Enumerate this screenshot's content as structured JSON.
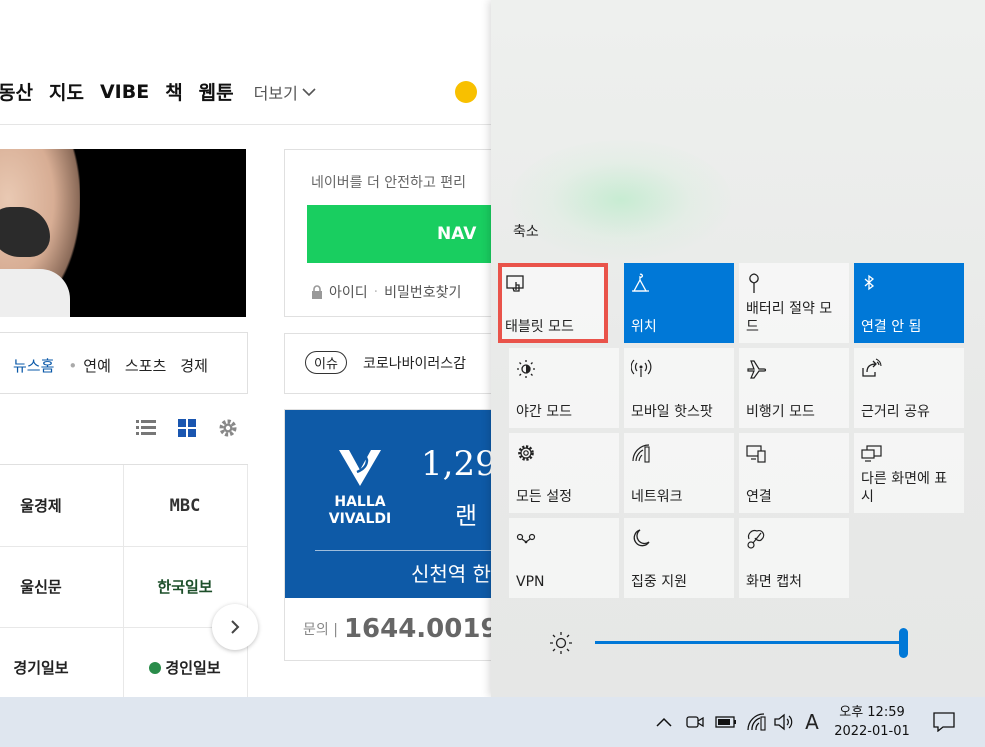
{
  "naver": {
    "nav_items": [
      "동산",
      "지도",
      "VIBE",
      "책",
      "웹툰"
    ],
    "nav_more": "더보기",
    "news_home": "뉴스홈",
    "news_links": [
      "연예",
      "스포츠",
      "경제"
    ],
    "press": [
      "울경제",
      "MBC",
      "울신문",
      "한국일보",
      "경기일보",
      "경인일보"
    ],
    "login_text": "네이버를 더 안전하고 편리",
    "login_button": "NAV",
    "login_id": "아이디",
    "login_pw": "비밀번호찾기",
    "issue_badge": "이슈",
    "issue_text": "코로나바이러스감",
    "ad_logo_line1": "HALLA",
    "ad_logo_line2": "VIVALDI",
    "ad_number": "1,29",
    "ad_sub": "랜",
    "ad_station": "신천역 한",
    "ad_phone_label": "문의 |",
    "ad_phone": "1644.0019"
  },
  "action_center": {
    "collapse": "축소",
    "tiles": [
      {
        "label": "태블릿 모드",
        "icon": "tablet-mode-icon",
        "on": false
      },
      {
        "label": "위치",
        "icon": "location-icon",
        "on": true
      },
      {
        "label": "배터리 절약 모드",
        "icon": "battery-saver-icon",
        "on": false
      },
      {
        "label": "연결 안 됨",
        "icon": "bluetooth-icon",
        "on": true
      },
      {
        "label": "야간 모드",
        "icon": "night-light-icon",
        "on": false
      },
      {
        "label": "모바일 핫스팟",
        "icon": "mobile-hotspot-icon",
        "on": false
      },
      {
        "label": "비행기 모드",
        "icon": "airplane-icon",
        "on": false
      },
      {
        "label": "근거리 공유",
        "icon": "nearby-share-icon",
        "on": false
      },
      {
        "label": "모든 설정",
        "icon": "settings-gear-icon",
        "on": false
      },
      {
        "label": "네트워크",
        "icon": "network-icon",
        "on": false
      },
      {
        "label": "연결",
        "icon": "connect-icon",
        "on": false
      },
      {
        "label": "다른 화면에 표시",
        "icon": "project-icon",
        "on": false
      },
      {
        "label": "VPN",
        "icon": "vpn-icon",
        "on": false
      },
      {
        "label": "집중 지원",
        "icon": "focus-assist-icon",
        "on": false
      },
      {
        "label": "화면 캡처",
        "icon": "screen-snip-icon",
        "on": false
      }
    ],
    "brightness": 1.0
  },
  "taskbar": {
    "ime": "A",
    "time_period": "오후 12:59",
    "date": "2022-01-01"
  },
  "colors": {
    "accent": "#0078d7",
    "naver_green": "#19ce60",
    "highlight": "#e9534a"
  }
}
